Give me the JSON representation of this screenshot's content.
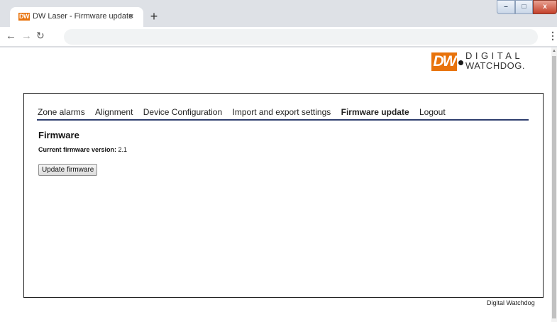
{
  "browser": {
    "tab_favicon": "DW",
    "tab_title": "DW Laser - Firmware update",
    "tab_close": "×",
    "new_tab": "+",
    "address": "",
    "window_controls": {
      "minimize": "–",
      "maximize": "□",
      "close": "x"
    }
  },
  "logo": {
    "mark": "DW",
    "line1": "DIGITAL",
    "line2": "WATCHDOG."
  },
  "nav": {
    "items": [
      {
        "label": "Zone alarms",
        "active": false
      },
      {
        "label": "Alignment",
        "active": false
      },
      {
        "label": "Device Configuration",
        "active": false
      },
      {
        "label": "Import and export settings",
        "active": false
      },
      {
        "label": "Firmware update",
        "active": true
      },
      {
        "label": "Logout",
        "active": false
      }
    ]
  },
  "firmware": {
    "heading": "Firmware",
    "version_label": "Current firmware version:",
    "version_value": "2.1",
    "update_button": "Update firmware"
  },
  "footer": {
    "text": "Digital Watchdog"
  },
  "colors": {
    "brand_orange": "#e8730c",
    "menu_rule": "#2e3e6e"
  }
}
